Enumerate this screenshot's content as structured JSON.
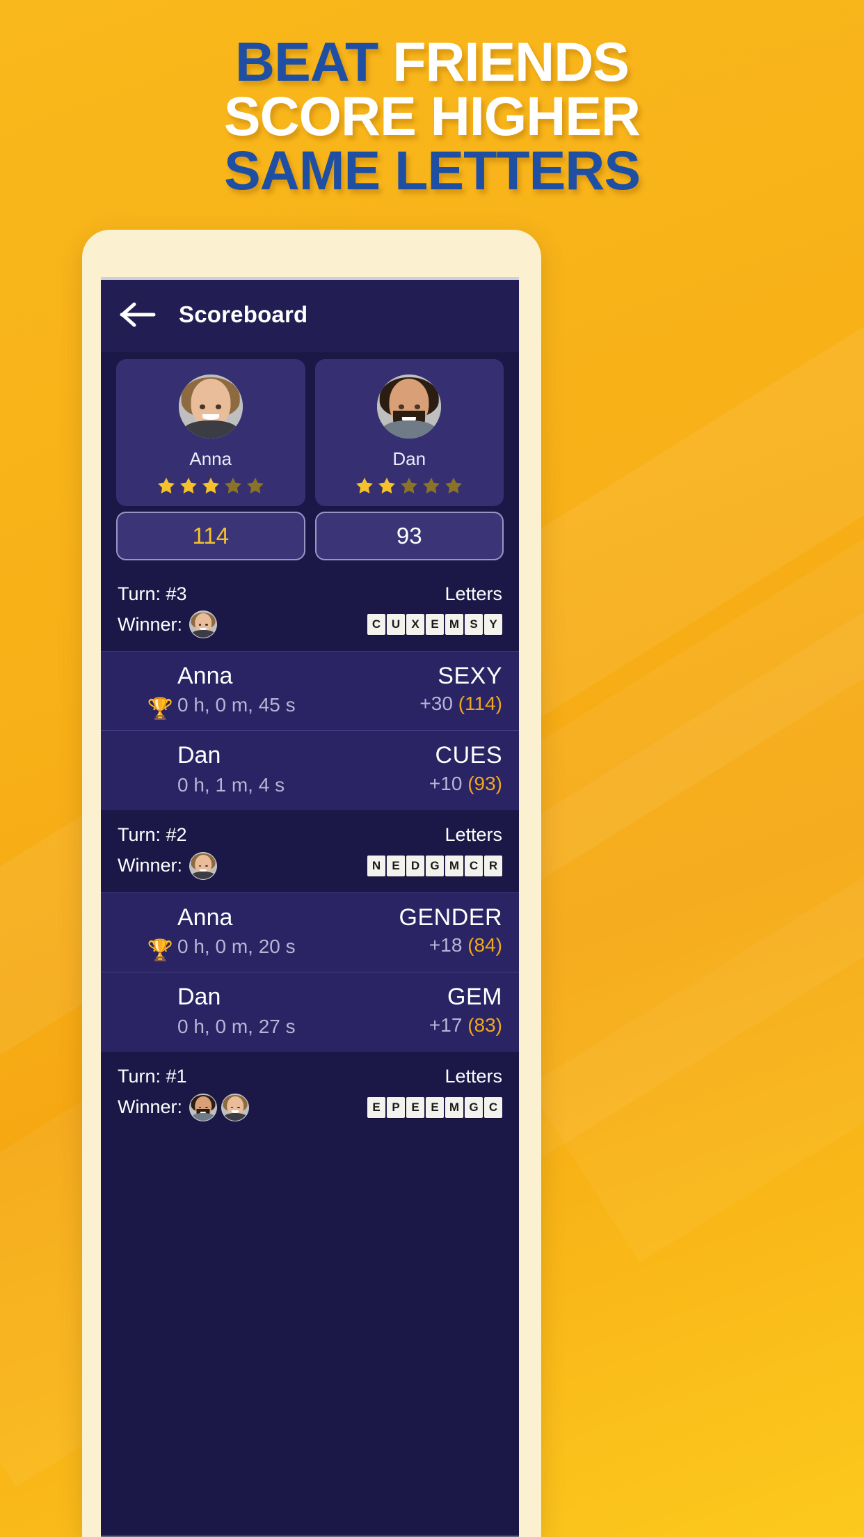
{
  "headline": {
    "lines": [
      {
        "parts": [
          {
            "text": "BEAT",
            "color": "blue"
          },
          {
            "text": "FRIENDS",
            "color": "white"
          }
        ]
      },
      {
        "parts": [
          {
            "text": "SCORE HIGHER",
            "color": "white"
          }
        ]
      },
      {
        "parts": [
          {
            "text": "SAME LETTERS",
            "color": "blue"
          }
        ]
      }
    ],
    "line1_blue": "BEAT",
    "line1_white": "FRIENDS",
    "line2": "SCORE HIGHER",
    "line3": "SAME LETTERS",
    "blue_hex": "#1f4fa3",
    "white_hex": "#ffffff",
    "background_hex": "#f8b118"
  },
  "appbar": {
    "title": "Scoreboard",
    "back_icon": "arrow-left-icon"
  },
  "players": [
    {
      "name": "Anna",
      "stars_filled": 3,
      "stars_total": 5,
      "score": "114",
      "score_color": "#f5c22b",
      "avatar": "anna-avatar"
    },
    {
      "name": "Dan",
      "stars_filled": 2,
      "stars_total": 5,
      "score": "93",
      "score_color": "#ffffff",
      "avatar": "dan-avatar"
    }
  ],
  "labels": {
    "turn_prefix": "Turn: ",
    "winner_prefix": "Winner:",
    "letters_label": "Letters"
  },
  "turns": [
    {
      "turn": "Turn: #3",
      "winner_label": "Winner:",
      "winners": [
        "anna-avatar"
      ],
      "letters_label": "Letters",
      "letters": [
        "C",
        "U",
        "X",
        "E",
        "M",
        "S",
        "Y"
      ],
      "moves": [
        {
          "player": "Anna",
          "avatar": "anna-avatar",
          "trophy": true,
          "time": "0 h, 0 m, 45 s",
          "word": "SEXY",
          "points": "+30",
          "total": "(114)"
        },
        {
          "player": "Dan",
          "avatar": "dan-avatar",
          "trophy": false,
          "time": "0 h, 1 m, 4 s",
          "word": "CUES",
          "points": "+10",
          "total": "(93)"
        }
      ]
    },
    {
      "turn": "Turn: #2",
      "winner_label": "Winner:",
      "winners": [
        "anna-avatar"
      ],
      "letters_label": "Letters",
      "letters": [
        "N",
        "E",
        "D",
        "G",
        "M",
        "C",
        "R"
      ],
      "moves": [
        {
          "player": "Anna",
          "avatar": "anna-avatar",
          "trophy": true,
          "time": "0 h, 0 m, 20 s",
          "word": "GENDER",
          "points": "+18",
          "total": "(84)"
        },
        {
          "player": "Dan",
          "avatar": "dan-avatar",
          "trophy": false,
          "time": "0 h, 0 m, 27 s",
          "word": "GEM",
          "points": "+17",
          "total": "(83)"
        }
      ]
    },
    {
      "turn": "Turn: #1",
      "winner_label": "Winner:",
      "winners": [
        "dan-avatar",
        "anna-avatar"
      ],
      "letters_label": "Letters",
      "letters": [
        "E",
        "P",
        "E",
        "E",
        "M",
        "G",
        "C"
      ],
      "moves": []
    }
  ],
  "colors": {
    "screen_bg": "#1b1747",
    "appbar_bg": "#221d52",
    "card_bg": "#363073",
    "row_bg": "#2a2464",
    "accent_gold": "#f0a81c",
    "muted_text": "#b9b5d6",
    "tile_bg": "#f4f2ec",
    "phone_body": "#fbf0cf"
  }
}
